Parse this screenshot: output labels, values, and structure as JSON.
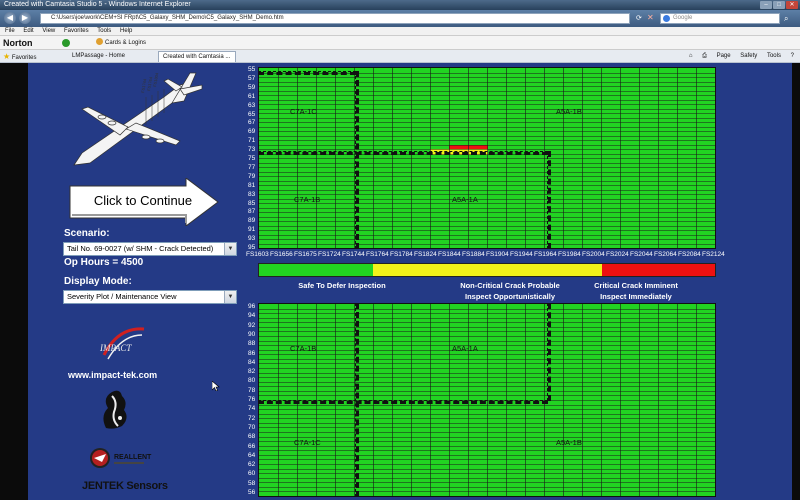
{
  "browser": {
    "title": "Created with Camtasia Studio 5 - Windows Internet Explorer",
    "address": "C:\\Users\\joe\\work\\CEM+SI FRpt\\C5_Galaxy_SHM_Demo\\C5_Galaxy_SHM_Demo.htm",
    "search_placeholder": "Google",
    "menu": [
      "File",
      "Edit",
      "View",
      "Favorites",
      "Tools",
      "Help"
    ],
    "norton_label": "Norton",
    "norton_cards": "Cards & Logins",
    "favorites_label": "Favorites",
    "tabs": [
      "LMPassage - Home",
      "Created with Camtasia ..."
    ],
    "toolbar_right": [
      "Page",
      "Safety",
      "Tools"
    ]
  },
  "left": {
    "continue_label": "Click to Continue",
    "scenario_label": "Scenario:",
    "scenario_value": "Tail No. 69-0027 (w/ SHM - Crack Detected)",
    "op_hours": "Op Hours = 4500",
    "display_mode_label": "Display Mode:",
    "display_mode_value": "Severity Plot / Maintenance View",
    "impact_logo": "IMPACT",
    "impact_url": "www.impact-tek.com",
    "reallent": "REALLENT",
    "jentek": "JENTEK Sensors"
  },
  "top_grid": {
    "y_labels": [
      "55",
      "57",
      "59",
      "61",
      "63",
      "65",
      "67",
      "69",
      "71",
      "73",
      "75",
      "77",
      "79",
      "81",
      "83",
      "85",
      "87",
      "89",
      "91",
      "93",
      "95"
    ],
    "zones": [
      "C7A-1C",
      "A5A-1B",
      "C7A-1B",
      "A5A-1A"
    ],
    "critical_cell": "red",
    "warning_cells": "yellow"
  },
  "fs_labels": [
    "FS1603",
    "FS1656",
    "FS1675",
    "FS1724",
    "FS1744",
    "FS1764",
    "FS1784",
    "FS1824",
    "FS1844",
    "FS1884",
    "FS1904",
    "FS1944",
    "FS1964",
    "FS1984",
    "FS2004",
    "FS2024",
    "FS2044",
    "FS2064",
    "FS2084",
    "FS2124"
  ],
  "legend": {
    "safe": "Safe To Defer Inspection",
    "noncritical_line1": "Non-Critical Crack Probable",
    "noncritical_line2": "Inspect Opportunistically",
    "critical_line1": "Critical Crack Imminent",
    "critical_line2": "Inspect Immediately",
    "colors": {
      "safe": "#22d322",
      "noncritical": "#f2f21a",
      "critical": "#ee1111"
    }
  },
  "bottom_grid": {
    "y_labels": [
      "96",
      "94",
      "92",
      "90",
      "88",
      "86",
      "84",
      "82",
      "80",
      "78",
      "76",
      "74",
      "72",
      "70",
      "68",
      "66",
      "64",
      "62",
      "60",
      "58",
      "56"
    ],
    "zones": [
      "C7A-1B",
      "A5A-1A",
      "C7A-1C",
      "A5A-1B"
    ]
  }
}
